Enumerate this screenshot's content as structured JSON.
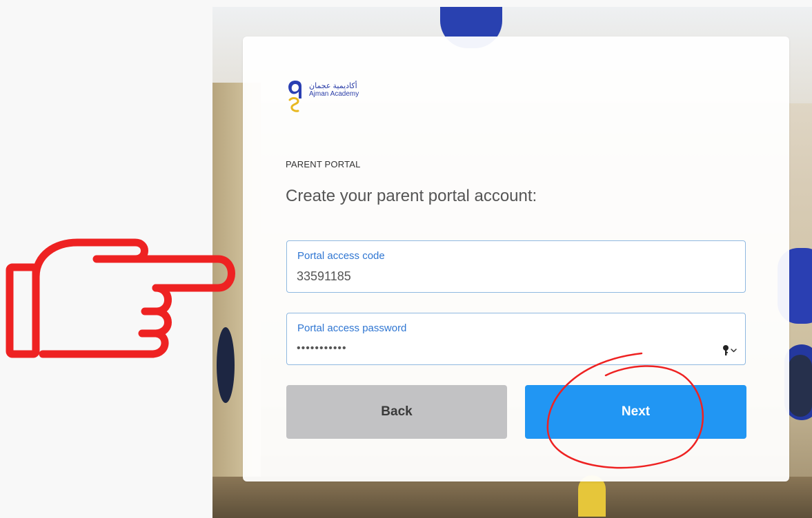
{
  "logo": {
    "arabic_name": "أكاديمية عجمان",
    "english_name": "Ajman Academy"
  },
  "portal": {
    "section_label": "PARENT PORTAL",
    "heading": "Create your parent portal account:"
  },
  "fields": {
    "access_code": {
      "label": "Portal access code",
      "value": "33591185"
    },
    "access_password": {
      "label": "Portal access password",
      "value": "•••••••••••"
    }
  },
  "buttons": {
    "back_label": "Back",
    "next_label": "Next"
  },
  "icons": {
    "password_manager": "key-icon"
  },
  "colors": {
    "primary": "#2196f3",
    "secondary": "#c2c2c4",
    "label_blue": "#2f76d2",
    "field_border": "#8fb8e0",
    "annotation_red": "#ee2222"
  }
}
